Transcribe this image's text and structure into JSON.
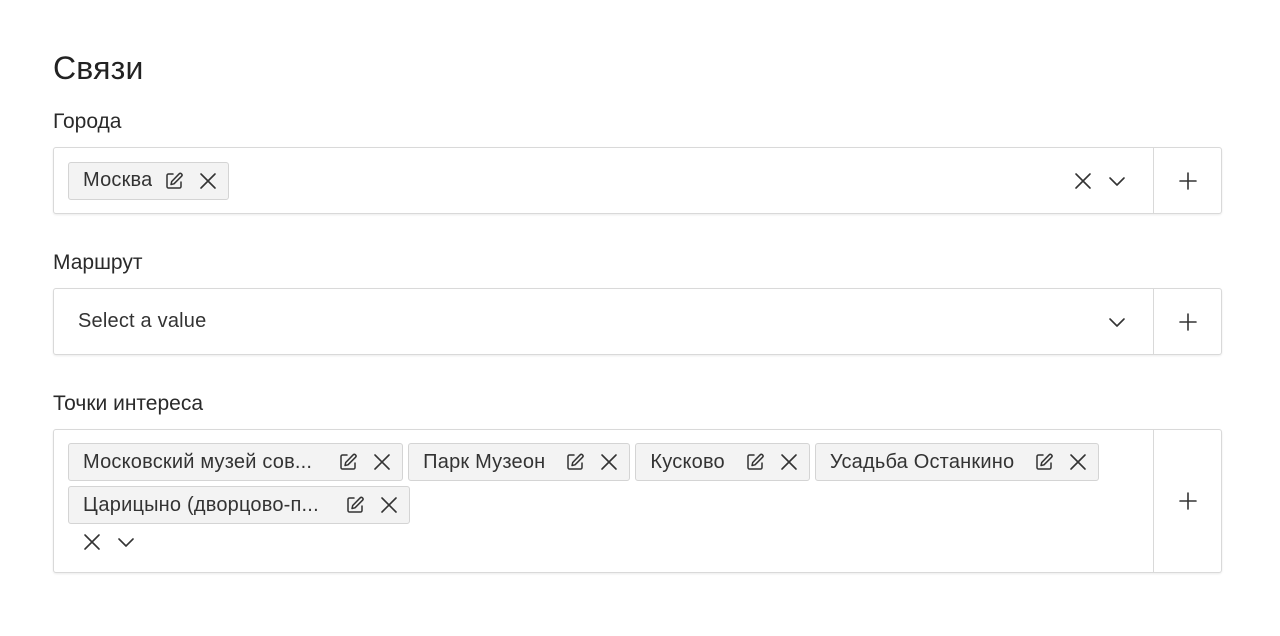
{
  "section": {
    "title": "Связи"
  },
  "cities": {
    "label": "Города",
    "chips": [
      {
        "label": "Москва"
      }
    ]
  },
  "route": {
    "label": "Маршрут",
    "placeholder": "Select a value"
  },
  "poi": {
    "label": "Точки интереса",
    "chips": [
      {
        "label": "Московский музей сов..."
      },
      {
        "label": "Парк Музеон"
      },
      {
        "label": "Кусково"
      },
      {
        "label": "Усадьба Останкино"
      },
      {
        "label": "Царицыно (дворцово-п..."
      }
    ]
  },
  "icons": {
    "edit": "edit-icon",
    "remove": "close-icon",
    "clear": "close-icon",
    "dropdown": "chevron-down-icon",
    "add": "plus-icon"
  },
  "colors": {
    "border": "#d9d9d9",
    "chip_bg": "#f3f3f3",
    "text": "#333333"
  }
}
